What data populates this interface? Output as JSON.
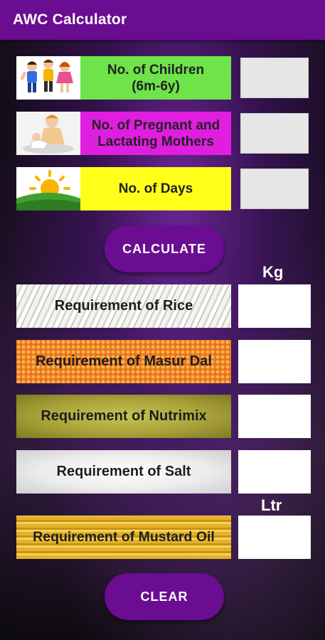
{
  "appbar": {
    "title": "AWC Calculator"
  },
  "inputs": [
    {
      "label": "No. of Children (6m-6y)",
      "color": "#6ee34a",
      "icon": "children-icon",
      "value": ""
    },
    {
      "label": "No. of Pregnant and Lactating Mothers",
      "color": "#e01ee0",
      "icon": "mother-baby-icon",
      "value": ""
    },
    {
      "label": "No. of Days",
      "color": "#ffff1a",
      "icon": "sunrise-icon",
      "value": ""
    }
  ],
  "buttons": {
    "calculate": "CALCULATE",
    "clear": "CLEAR"
  },
  "units": {
    "kg": "Kg",
    "ltr": "Ltr"
  },
  "results": [
    {
      "label": "Requirement of Rice",
      "texture": "rice",
      "value": ""
    },
    {
      "label": "Requirement of Masur Dal",
      "texture": "masur-dal",
      "value": ""
    },
    {
      "label": "Requirement of Nutrimix",
      "texture": "nutrimix",
      "value": ""
    },
    {
      "label": "Requirement of Salt",
      "texture": "salt",
      "value": ""
    },
    {
      "label": "Requirement of Mustard Oil",
      "texture": "mustard-oil",
      "value": ""
    }
  ],
  "colors": {
    "primary": "#6a0d91"
  }
}
